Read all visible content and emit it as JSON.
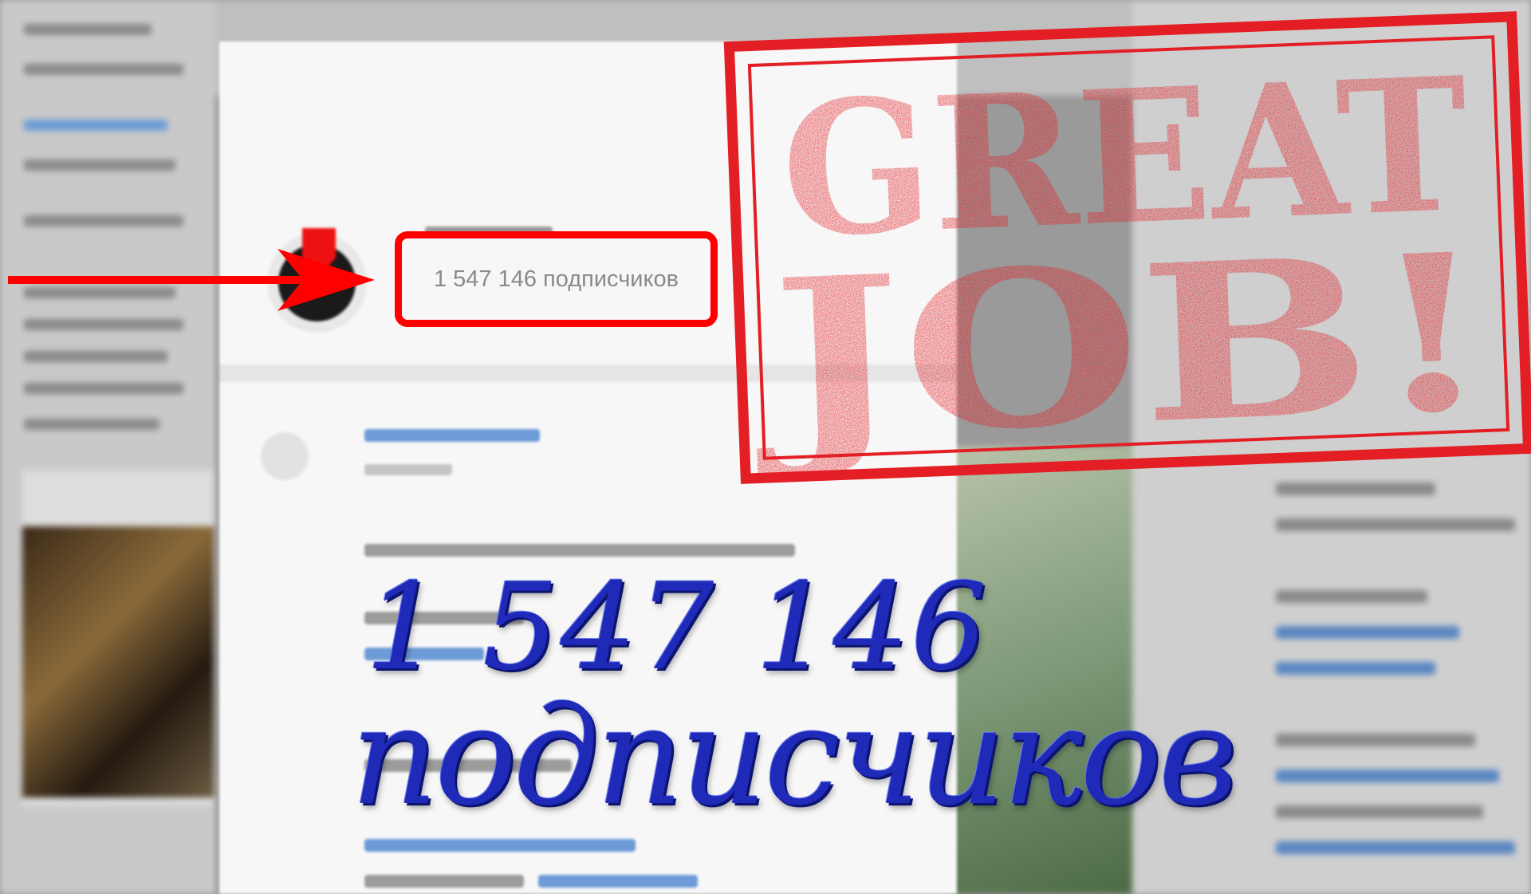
{
  "channel_info": {
    "subscribers_label": "1 547 146 подписчиков"
  },
  "stamp": {
    "line1": "GREAT",
    "line2": "JOB!",
    "color": "#e31e24"
  },
  "overlay": {
    "number": "1 547 146",
    "word": "подписчиков",
    "color": "#1f2bb8"
  },
  "arrow": {
    "color": "#ff0000",
    "icon": "arrow-right-icon"
  }
}
